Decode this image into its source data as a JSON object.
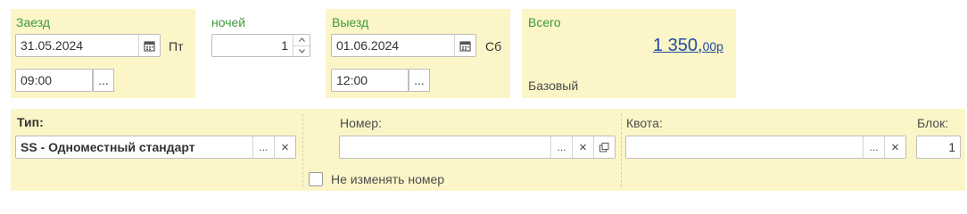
{
  "checkin": {
    "label": "Заезд",
    "date": "31.05.2024",
    "weekday": "Пт",
    "time": "09:00"
  },
  "nights": {
    "label": "ночей",
    "value": "1"
  },
  "checkout": {
    "label": "Выезд",
    "date": "01.06.2024",
    "weekday": "Сб",
    "time": "12:00"
  },
  "total": {
    "label": "Всего",
    "amount_main": "1 350,",
    "amount_fraction": "00р",
    "tariff": "Базовый"
  },
  "room": {
    "type_label": "Тип:",
    "type_value": "SS - Одноместный стандарт",
    "number_label": "Номер:",
    "number_value": "",
    "keep_number_label": "Не изменять номер",
    "keep_number_checked": false,
    "quota_label": "Квота:",
    "quota_value": "",
    "block_label": "Блок:",
    "block_value": "1"
  },
  "buttons": {
    "select": "...",
    "clear": "×"
  },
  "colors": {
    "panel_bg": "#fbf5c8",
    "label_green": "#3a9a3a",
    "link_blue": "#1f4ea1"
  }
}
